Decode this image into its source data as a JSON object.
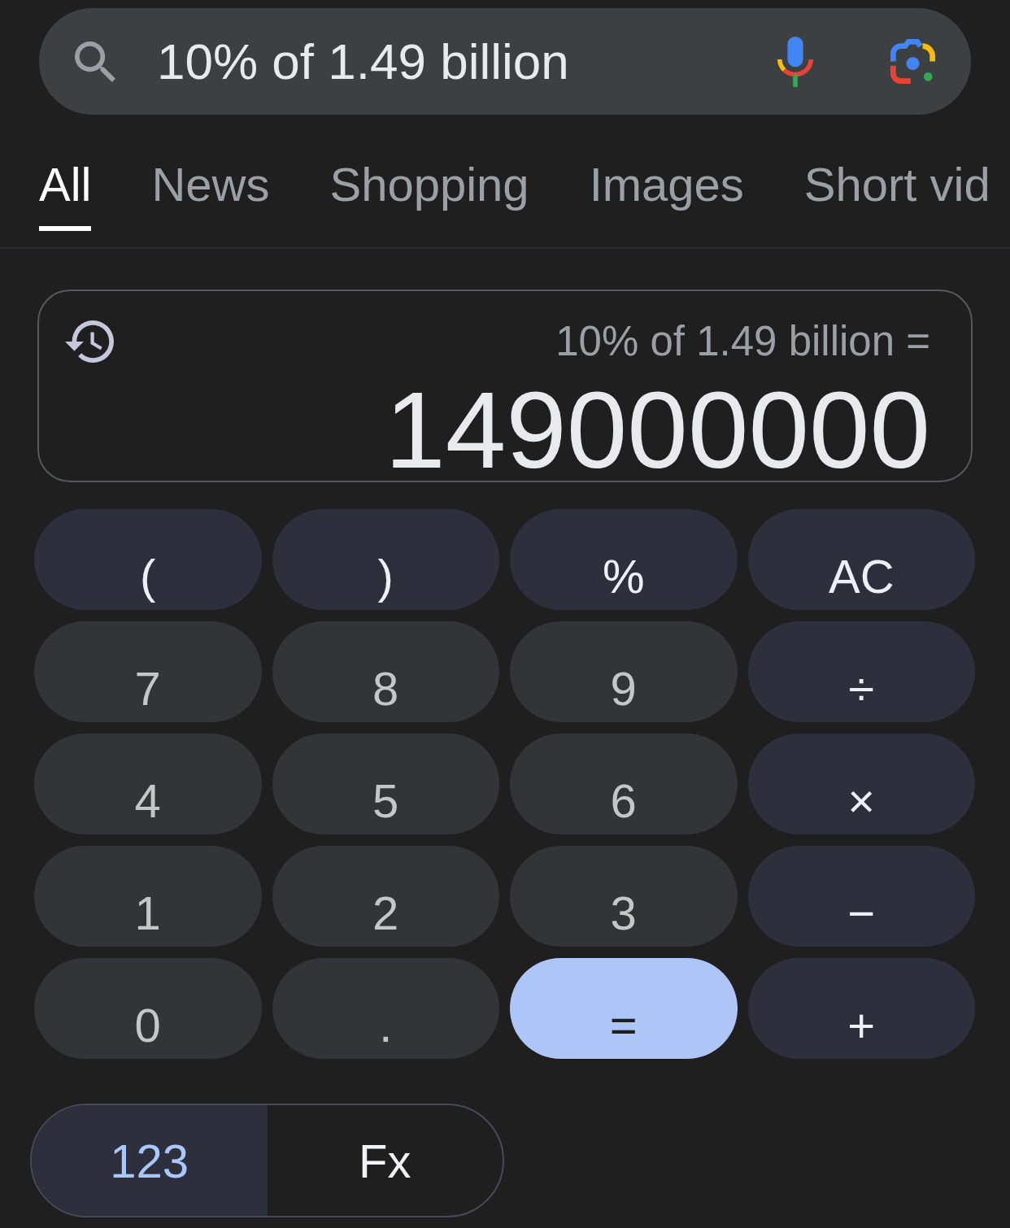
{
  "search": {
    "query": "10% of 1.49 billion"
  },
  "tabs": [
    {
      "label": "All",
      "selected": true
    },
    {
      "label": "News",
      "selected": false
    },
    {
      "label": "Shopping",
      "selected": false
    },
    {
      "label": "Images",
      "selected": false
    },
    {
      "label": "Short vid",
      "selected": false
    }
  ],
  "calculator": {
    "expression": "10% of 1.49 billion =",
    "result": "149000000",
    "keys": [
      {
        "label": "(",
        "kind": "function"
      },
      {
        "label": ")",
        "kind": "function"
      },
      {
        "label": "%",
        "kind": "function"
      },
      {
        "label": "AC",
        "kind": "function"
      },
      {
        "label": "7",
        "kind": "digit"
      },
      {
        "label": "8",
        "kind": "digit"
      },
      {
        "label": "9",
        "kind": "digit"
      },
      {
        "label": "÷",
        "kind": "operator"
      },
      {
        "label": "4",
        "kind": "digit"
      },
      {
        "label": "5",
        "kind": "digit"
      },
      {
        "label": "6",
        "kind": "digit"
      },
      {
        "label": "×",
        "kind": "operator"
      },
      {
        "label": "1",
        "kind": "digit"
      },
      {
        "label": "2",
        "kind": "digit"
      },
      {
        "label": "3",
        "kind": "digit"
      },
      {
        "label": "−",
        "kind": "operator"
      },
      {
        "label": "0",
        "kind": "digit"
      },
      {
        "label": ".",
        "kind": "digit"
      },
      {
        "label": "=",
        "kind": "equals"
      },
      {
        "label": "+",
        "kind": "operator"
      }
    ],
    "modes": [
      {
        "label": "123",
        "selected": true
      },
      {
        "label": "Fx",
        "selected": false
      }
    ]
  }
}
